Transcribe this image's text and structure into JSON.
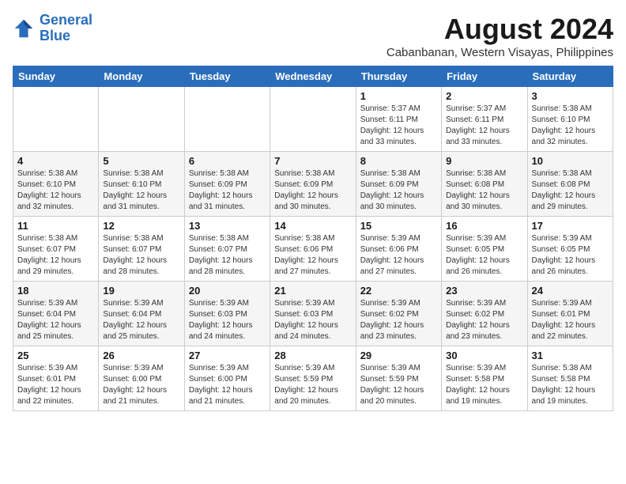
{
  "logo": {
    "line1": "General",
    "line2": "Blue"
  },
  "title": "August 2024",
  "subtitle": "Cabanbanan, Western Visayas, Philippines",
  "days": [
    "Sunday",
    "Monday",
    "Tuesday",
    "Wednesday",
    "Thursday",
    "Friday",
    "Saturday"
  ],
  "weeks": [
    [
      {
        "day": "",
        "info": ""
      },
      {
        "day": "",
        "info": ""
      },
      {
        "day": "",
        "info": ""
      },
      {
        "day": "",
        "info": ""
      },
      {
        "day": "1",
        "info": "Sunrise: 5:37 AM\nSunset: 6:11 PM\nDaylight: 12 hours\nand 33 minutes."
      },
      {
        "day": "2",
        "info": "Sunrise: 5:37 AM\nSunset: 6:11 PM\nDaylight: 12 hours\nand 33 minutes."
      },
      {
        "day": "3",
        "info": "Sunrise: 5:38 AM\nSunset: 6:10 PM\nDaylight: 12 hours\nand 32 minutes."
      }
    ],
    [
      {
        "day": "4",
        "info": "Sunrise: 5:38 AM\nSunset: 6:10 PM\nDaylight: 12 hours\nand 32 minutes."
      },
      {
        "day": "5",
        "info": "Sunrise: 5:38 AM\nSunset: 6:10 PM\nDaylight: 12 hours\nand 31 minutes."
      },
      {
        "day": "6",
        "info": "Sunrise: 5:38 AM\nSunset: 6:09 PM\nDaylight: 12 hours\nand 31 minutes."
      },
      {
        "day": "7",
        "info": "Sunrise: 5:38 AM\nSunset: 6:09 PM\nDaylight: 12 hours\nand 30 minutes."
      },
      {
        "day": "8",
        "info": "Sunrise: 5:38 AM\nSunset: 6:09 PM\nDaylight: 12 hours\nand 30 minutes."
      },
      {
        "day": "9",
        "info": "Sunrise: 5:38 AM\nSunset: 6:08 PM\nDaylight: 12 hours\nand 30 minutes."
      },
      {
        "day": "10",
        "info": "Sunrise: 5:38 AM\nSunset: 6:08 PM\nDaylight: 12 hours\nand 29 minutes."
      }
    ],
    [
      {
        "day": "11",
        "info": "Sunrise: 5:38 AM\nSunset: 6:07 PM\nDaylight: 12 hours\nand 29 minutes."
      },
      {
        "day": "12",
        "info": "Sunrise: 5:38 AM\nSunset: 6:07 PM\nDaylight: 12 hours\nand 28 minutes."
      },
      {
        "day": "13",
        "info": "Sunrise: 5:38 AM\nSunset: 6:07 PM\nDaylight: 12 hours\nand 28 minutes."
      },
      {
        "day": "14",
        "info": "Sunrise: 5:38 AM\nSunset: 6:06 PM\nDaylight: 12 hours\nand 27 minutes."
      },
      {
        "day": "15",
        "info": "Sunrise: 5:39 AM\nSunset: 6:06 PM\nDaylight: 12 hours\nand 27 minutes."
      },
      {
        "day": "16",
        "info": "Sunrise: 5:39 AM\nSunset: 6:05 PM\nDaylight: 12 hours\nand 26 minutes."
      },
      {
        "day": "17",
        "info": "Sunrise: 5:39 AM\nSunset: 6:05 PM\nDaylight: 12 hours\nand 26 minutes."
      }
    ],
    [
      {
        "day": "18",
        "info": "Sunrise: 5:39 AM\nSunset: 6:04 PM\nDaylight: 12 hours\nand 25 minutes."
      },
      {
        "day": "19",
        "info": "Sunrise: 5:39 AM\nSunset: 6:04 PM\nDaylight: 12 hours\nand 25 minutes."
      },
      {
        "day": "20",
        "info": "Sunrise: 5:39 AM\nSunset: 6:03 PM\nDaylight: 12 hours\nand 24 minutes."
      },
      {
        "day": "21",
        "info": "Sunrise: 5:39 AM\nSunset: 6:03 PM\nDaylight: 12 hours\nand 24 minutes."
      },
      {
        "day": "22",
        "info": "Sunrise: 5:39 AM\nSunset: 6:02 PM\nDaylight: 12 hours\nand 23 minutes."
      },
      {
        "day": "23",
        "info": "Sunrise: 5:39 AM\nSunset: 6:02 PM\nDaylight: 12 hours\nand 23 minutes."
      },
      {
        "day": "24",
        "info": "Sunrise: 5:39 AM\nSunset: 6:01 PM\nDaylight: 12 hours\nand 22 minutes."
      }
    ],
    [
      {
        "day": "25",
        "info": "Sunrise: 5:39 AM\nSunset: 6:01 PM\nDaylight: 12 hours\nand 22 minutes."
      },
      {
        "day": "26",
        "info": "Sunrise: 5:39 AM\nSunset: 6:00 PM\nDaylight: 12 hours\nand 21 minutes."
      },
      {
        "day": "27",
        "info": "Sunrise: 5:39 AM\nSunset: 6:00 PM\nDaylight: 12 hours\nand 21 minutes."
      },
      {
        "day": "28",
        "info": "Sunrise: 5:39 AM\nSunset: 5:59 PM\nDaylight: 12 hours\nand 20 minutes."
      },
      {
        "day": "29",
        "info": "Sunrise: 5:39 AM\nSunset: 5:59 PM\nDaylight: 12 hours\nand 20 minutes."
      },
      {
        "day": "30",
        "info": "Sunrise: 5:39 AM\nSunset: 5:58 PM\nDaylight: 12 hours\nand 19 minutes."
      },
      {
        "day": "31",
        "info": "Sunrise: 5:38 AM\nSunset: 5:58 PM\nDaylight: 12 hours\nand 19 minutes."
      }
    ]
  ]
}
